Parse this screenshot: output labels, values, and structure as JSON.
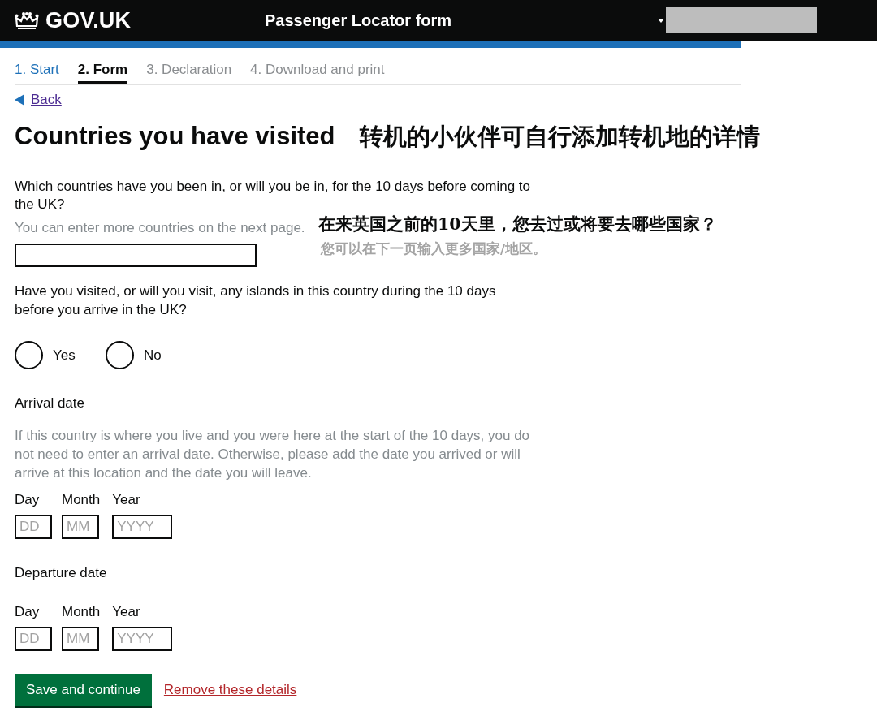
{
  "header": {
    "logo_text": "GOV.UK",
    "service_name": "Passenger Locator form"
  },
  "steps": [
    {
      "label": "1. Start",
      "selected": false,
      "completed": true
    },
    {
      "label": "2. Form",
      "selected": true,
      "completed": false
    },
    {
      "label": "3. Declaration",
      "selected": false,
      "completed": false
    },
    {
      "label": "4. Download and print",
      "selected": false,
      "completed": false
    }
  ],
  "back_link": "Back",
  "page_title": "Countries you have visited",
  "title_note": "转机的小伙伴可自行添加转机地的详情",
  "fields": [
    {
      "kind": "text",
      "label": "Which countries have you been in, or will you be in, for the 10 days before coming to the UK?",
      "hint": "You can enter more countries on the next page.",
      "note": "在来英国之前的10天里，您去过或将要去哪些国家？",
      "note_hint": "您可以在下一页输入更多国家/地区。"
    },
    {
      "kind": "radio",
      "label": "Have you visited, or will you visit, any islands in this country during the 10 days before you arrive in the UK?",
      "options": [
        {
          "label": "Yes",
          "selected": false
        },
        {
          "label": "No",
          "selected": false
        }
      ]
    },
    {
      "kind": "date",
      "label": "Arrival date",
      "hint": "If this country is where you live and you were here at the start of the 10 days, you do not need to enter an arrival date. Otherwise, please add the date you arrived or will arrive at this location and the date you will leave.",
      "parts": [
        {
          "label": "Day",
          "placeholder": "DD"
        },
        {
          "label": "Month",
          "placeholder": "MM"
        },
        {
          "label": "Year",
          "placeholder": "YYYY"
        }
      ]
    },
    {
      "kind": "date",
      "label": "Departure date",
      "parts": [
        {
          "label": "Day",
          "placeholder": "DD"
        },
        {
          "label": "Month",
          "placeholder": "MM"
        },
        {
          "label": "Year",
          "placeholder": "YYYY"
        }
      ]
    }
  ],
  "actions": {
    "primary": "Save and continue",
    "secondary": "Remove these details"
  }
}
